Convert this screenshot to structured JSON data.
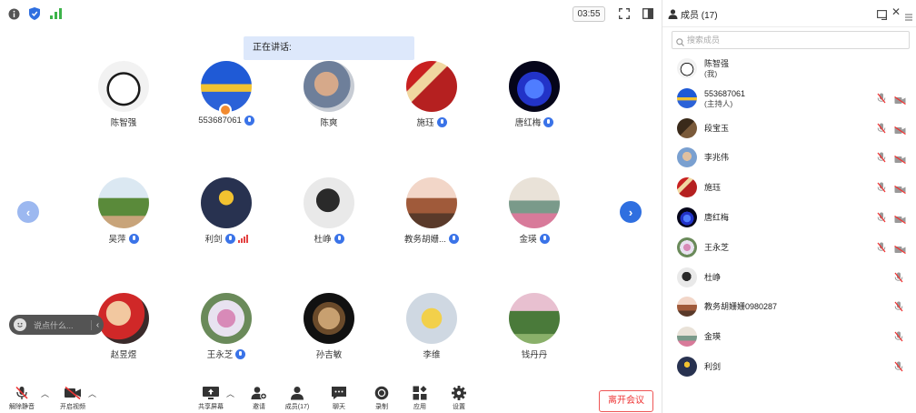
{
  "toolbar_top": {
    "timer": "03:55"
  },
  "speaking": {
    "label": "正在讲话:"
  },
  "nav": {
    "prev": "‹",
    "next": "›"
  },
  "chat": {
    "placeholder": "说点什么..."
  },
  "participants": [
    {
      "name": "陈智强",
      "muted_badge": false,
      "host_badge": false,
      "signal": false
    },
    {
      "name": "553687061",
      "muted_badge": true,
      "host_badge": true,
      "signal": false
    },
    {
      "name": "陈爽",
      "muted_badge": false,
      "host_badge": false,
      "signal": false
    },
    {
      "name": "施珏",
      "muted_badge": true,
      "host_badge": false,
      "signal": false
    },
    {
      "name": "唐红梅",
      "muted_badge": true,
      "host_badge": false,
      "signal": false
    },
    {
      "name": "吴萍",
      "muted_badge": true,
      "host_badge": false,
      "signal": false
    },
    {
      "name": "利剑",
      "muted_badge": true,
      "host_badge": false,
      "signal": true
    },
    {
      "name": "杜峥",
      "muted_badge": true,
      "host_badge": false,
      "signal": false
    },
    {
      "name": "教务胡姗...",
      "muted_badge": true,
      "host_badge": false,
      "signal": false
    },
    {
      "name": "金瑛",
      "muted_badge": true,
      "host_badge": false,
      "signal": false
    },
    {
      "name": "赵昱煜",
      "muted_badge": false,
      "host_badge": false,
      "signal": false
    },
    {
      "name": "王永芝",
      "muted_badge": true,
      "host_badge": false,
      "signal": false
    },
    {
      "name": "孙吉敏",
      "muted_badge": false,
      "host_badge": false,
      "signal": false
    },
    {
      "name": "李维",
      "muted_badge": false,
      "host_badge": false,
      "signal": false
    },
    {
      "name": "钱丹丹",
      "muted_badge": false,
      "host_badge": false,
      "signal": false
    }
  ],
  "bottom_toolbar": {
    "unmute": "解除静音",
    "start_video": "开启视频",
    "share_screen": "共享屏幕",
    "invite": "邀请",
    "members": "成员(17)",
    "chat": "聊天",
    "record": "录制",
    "apps": "应用",
    "settings": "设置",
    "leave": "离开会议"
  },
  "panel": {
    "title": "成员 (17)",
    "search_placeholder": "搜索成员",
    "members": [
      {
        "name": "陈智强",
        "sub": "(我)",
        "mic": false,
        "cam": false
      },
      {
        "name": "553687061",
        "sub": "(主持人)",
        "mic": true,
        "cam": true
      },
      {
        "name": "段宝玉",
        "sub": "",
        "mic": true,
        "cam": true
      },
      {
        "name": "李兆伟",
        "sub": "",
        "mic": true,
        "cam": true
      },
      {
        "name": "施珏",
        "sub": "",
        "mic": true,
        "cam": true
      },
      {
        "name": "唐红梅",
        "sub": "",
        "mic": true,
        "cam": true
      },
      {
        "name": "王永芝",
        "sub": "",
        "mic": true,
        "cam": true
      },
      {
        "name": "杜峥",
        "sub": "",
        "mic": true,
        "cam": false
      },
      {
        "name": "教务胡姗姗0980287",
        "sub": "",
        "mic": true,
        "cam": false
      },
      {
        "name": "金瑛",
        "sub": "",
        "mic": true,
        "cam": false
      },
      {
        "name": "利剑",
        "sub": "",
        "mic": true,
        "cam": false
      }
    ]
  },
  "colors": {
    "accent_blue": "#3a73e8",
    "muted_red": "#e34242",
    "speaking_bg": "#dde8fb",
    "leave_red": "#e33333"
  }
}
